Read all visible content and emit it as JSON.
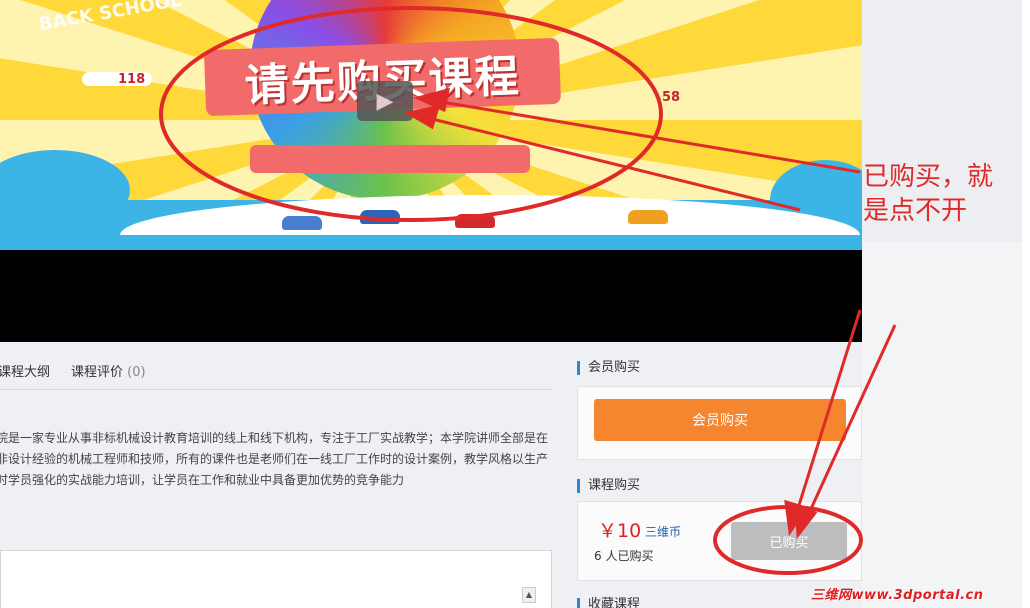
{
  "video": {
    "banner_title": "请先购买课程",
    "banner_tag_left": "118",
    "banner_tag_right": "58",
    "banner_deco": "BACK SCHOOL"
  },
  "tabs": [
    {
      "label": "课程大纲"
    },
    {
      "label": "课程评价",
      "count": "(0)"
    }
  ],
  "description": {
    "lines": [
      "院是一家专业从事非标机械设计教育培训的线上和线下机构，专注于工厂实战教学；本学院讲师全部是在",
      "非设计经验的机械工程师和技师，所有的课件也是老师们在一线工厂工作时的设计案例，教学风格以生产",
      "时学员强化的实战能力培训，让学员在工作和就业中具备更加优势的竞争能力"
    ]
  },
  "member_purchase": {
    "section_title": "会员购买",
    "button_label": "会员购买"
  },
  "course_purchase": {
    "section_title": "课程购买",
    "price": "￥10",
    "currency_label": "三维币",
    "bought_count": "6 人已购买",
    "button_label": "已购买"
  },
  "favorites": {
    "section_title": "收藏课程"
  },
  "annotation": {
    "note_line1": "已购买，就",
    "note_line2": "是点不开",
    "watermark": "三维网www.3dportal.cn",
    "color": "#e02a2a"
  },
  "colors": {
    "accent_orange": "#f5852f",
    "price_red": "#e02020",
    "section_blue": "#2b87d3",
    "disabled_gray": "#bdbdbd"
  }
}
